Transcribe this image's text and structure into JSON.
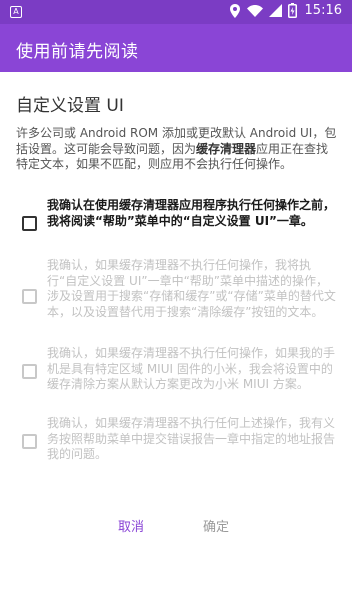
{
  "status_bar": {
    "left_icon_glyph": "A",
    "time": "15:16"
  },
  "app_bar": {
    "title": "使用前请先阅读"
  },
  "dialog": {
    "title": "自定义设置 UI",
    "intro_before": "许多公司或 Android ROM 添加或更改默认 Android UI，包括设置。这可能会导致问题，因为",
    "intro_bold": "缓存清理器",
    "intro_after": "应用正在查找特定文本，如果不匹配，则应用不会执行任何操作。",
    "options": [
      {
        "text": "我确认在使用缓存清理器应用程序执行任何操作之前，我将阅读“帮助”菜单中的“自定义设置 UI”一章。",
        "enabled": true
      },
      {
        "text": "我确认，如果缓存清理器不执行任何操作，我将执行“自定义设置 UI”一章中“帮助”菜单中描述的操作，涉及设置用于搜索“存储和缓存”或“存储”菜单的替代文本，以及设置替代用于搜索“清除缓存”按钮的文本。",
        "enabled": false
      },
      {
        "text": "我确认，如果缓存清理器不执行任何操作，如果我的手机是具有特定区域 MIUI 固件的小米，我会将设置中的缓存清除方案从默认方案更改为小米 MIUI 方案。",
        "enabled": false
      },
      {
        "text": "我确认，如果缓存清理器不执行任何上述操作，我有义务按照帮助菜单中提交错误报告一章中指定的地址报告我的问题。",
        "enabled": false
      }
    ]
  },
  "buttons": {
    "cancel": "取消",
    "confirm": "确定"
  },
  "colors": {
    "status_bar": "#7b3cc4",
    "app_bar": "#8a45d6",
    "accent": "#8a45d6"
  }
}
